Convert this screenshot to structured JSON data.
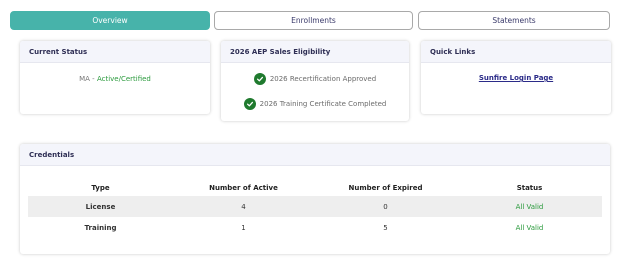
{
  "tabs": [
    {
      "label": "Overview",
      "active": true
    },
    {
      "label": "Enrollments",
      "active": false
    },
    {
      "label": "Statements",
      "active": false
    }
  ],
  "current_status": {
    "title": "Current Status",
    "state": "MA",
    "separator": " - ",
    "value": "Active/Certified"
  },
  "eligibility": {
    "title": "2026 AEP Sales Eligibility",
    "items": [
      {
        "label": "2026 Recertification Approved",
        "icon": "check-circle-icon"
      },
      {
        "label": "2026 Training Certificate Completed",
        "icon": "check-circle-icon"
      }
    ]
  },
  "quick_links": {
    "title": "Quick Links",
    "link": "Sunfire Login Page"
  },
  "credentials": {
    "title": "Credentials",
    "headers": [
      "Type",
      "Number of Active",
      "Number of Expired",
      "Status"
    ],
    "rows": [
      {
        "type": "License",
        "active": "4",
        "expired": "0",
        "status": "All Valid"
      },
      {
        "type": "Training",
        "active": "1",
        "expired": "5",
        "status": "All Valid"
      }
    ]
  },
  "colors": {
    "accent": "#47b3aa",
    "success": "#2a9a3c",
    "check": "#1f7a2e",
    "link": "#2b2b88"
  }
}
